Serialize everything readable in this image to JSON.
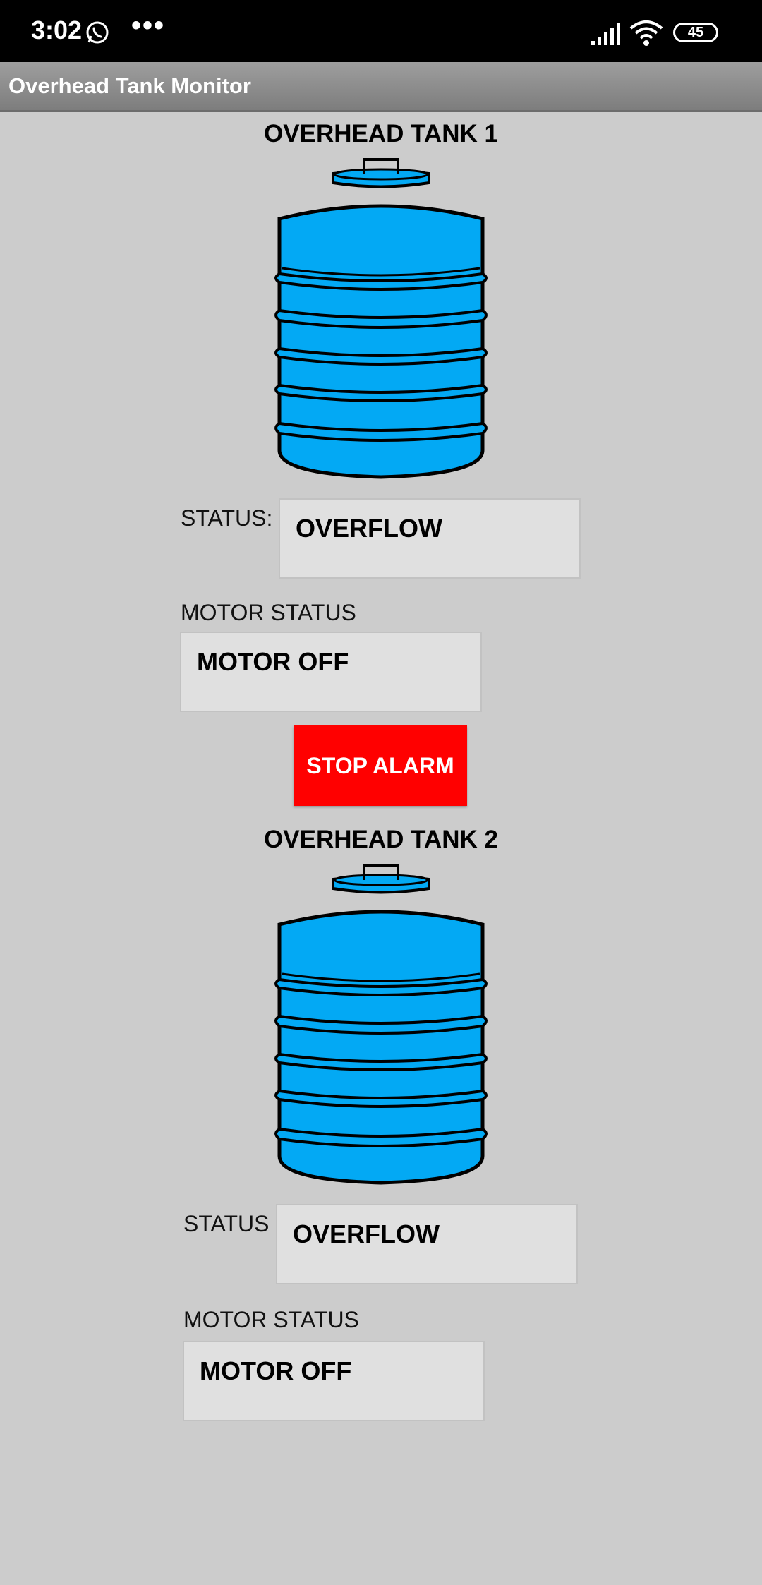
{
  "status_bar": {
    "time": "3:02",
    "notification_icons": [
      "whatsapp-icon",
      "more-icon"
    ],
    "more": "•••",
    "battery": "45"
  },
  "app": {
    "title": "Overhead Tank Monitor"
  },
  "tank1": {
    "title": "OVERHEAD TANK 1",
    "status_label": "STATUS:",
    "status_value": "OVERFLOW",
    "motor_label": "MOTOR STATUS",
    "motor_value": "MOTOR OFF"
  },
  "alarm_button": {
    "label": "STOP ALARM",
    "color": "#ff0000"
  },
  "tank2": {
    "title": "OVERHEAD TANK 2",
    "status_label": "STATUS",
    "status_value": "OVERFLOW",
    "motor_label": "MOTOR STATUS",
    "motor_value": "MOTOR OFF"
  },
  "colors": {
    "background": "#cccccc",
    "tank_fill": "#03a9f4",
    "field_bg": "#e0e0e0"
  }
}
